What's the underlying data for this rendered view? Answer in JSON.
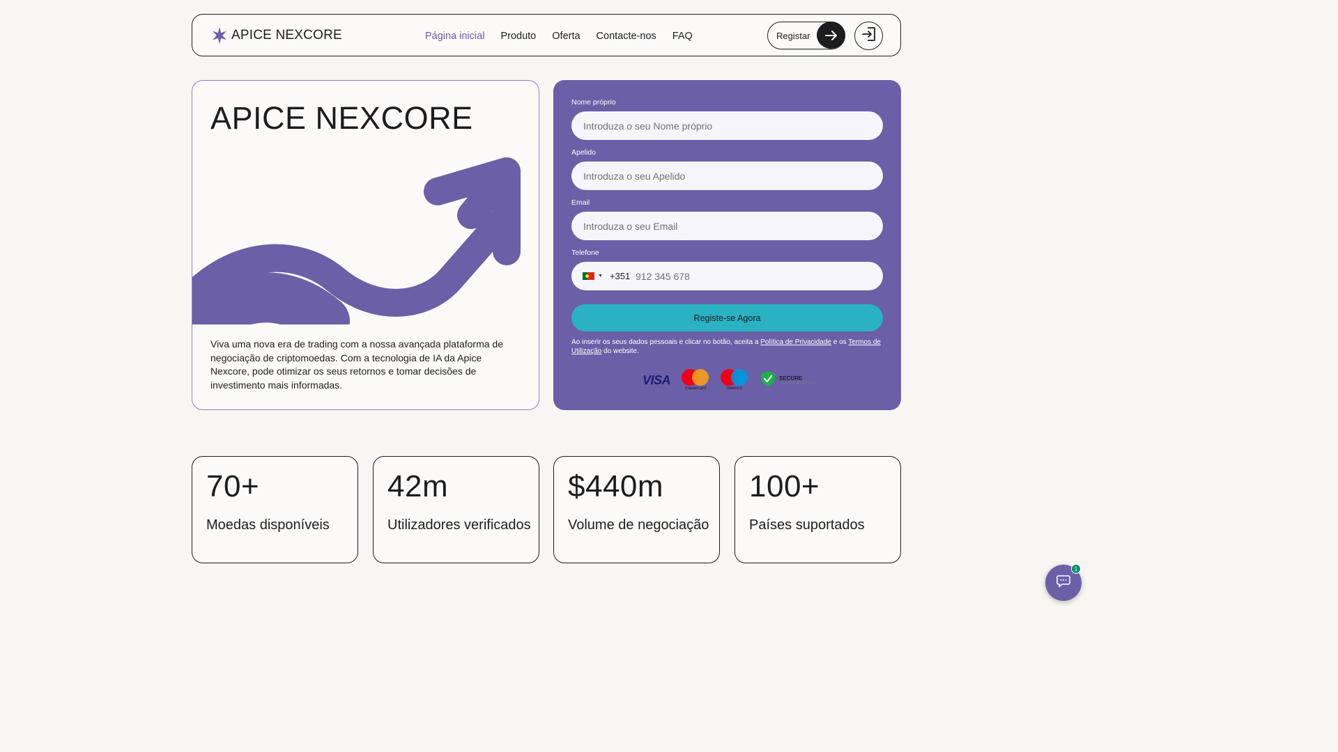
{
  "brand": {
    "name": "APICE NEXCORE",
    "accent_color": "#6b5fa7",
    "button_color": "#2bb2c2"
  },
  "nav": {
    "links": [
      {
        "label": "Página inicial",
        "active": true
      },
      {
        "label": "Produto",
        "active": false
      },
      {
        "label": "Oferta",
        "active": false
      },
      {
        "label": "Contacte-nos",
        "active": false
      },
      {
        "label": "FAQ",
        "active": false
      }
    ],
    "register_label": "Registar",
    "icons": {
      "register": "arrow-right-icon",
      "login": "login-icon"
    }
  },
  "hero": {
    "title": "APICE NEXCORE",
    "description": "Viva uma nova era de trading com a nossa avançada plataforma de negociação de criptomoedas. Com a tecnologia de IA da Apice Nexcore, pode otimizar os seus retornos e tomar decisões de investimento mais informadas."
  },
  "form": {
    "first_name": {
      "label": "Nome próprio",
      "placeholder": "Introduza o seu Nome próprio",
      "value": ""
    },
    "last_name": {
      "label": "Apelido",
      "placeholder": "Introduza o seu Apelido",
      "value": ""
    },
    "email": {
      "label": "Email",
      "placeholder": "Introduza o seu Email",
      "value": ""
    },
    "phone": {
      "label": "Telefone",
      "dial_code": "+351",
      "placeholder": "912 345 678",
      "value": "",
      "country_flag": "portugal-flag-icon"
    },
    "submit_label": "Registe-se Agora",
    "disclaimer": {
      "prefix": "Ao inserir os seus dados pessoais e clicar no botão, aceita a ",
      "privacy_link": "Política de Privacidade",
      "middle": " e os ",
      "terms_link": "Termos de Utilização",
      "suffix": " do website."
    },
    "payment": {
      "visa": "VISA",
      "mastercard": "mastercard",
      "maestro": "maestro",
      "secure_title": "SECURE",
      "secure_subtitle": "SSL ENCRYPTION"
    }
  },
  "stats": [
    {
      "value": "70+",
      "label": "Moedas disponíveis"
    },
    {
      "value": "42m",
      "label": "Utilizadores verificados"
    },
    {
      "value": "$440m",
      "label": "Volume de negociação"
    },
    {
      "value": "100+",
      "label": "Países suportados"
    }
  ],
  "chat": {
    "badge_count": "1",
    "icon": "chat-bubble-icon"
  }
}
